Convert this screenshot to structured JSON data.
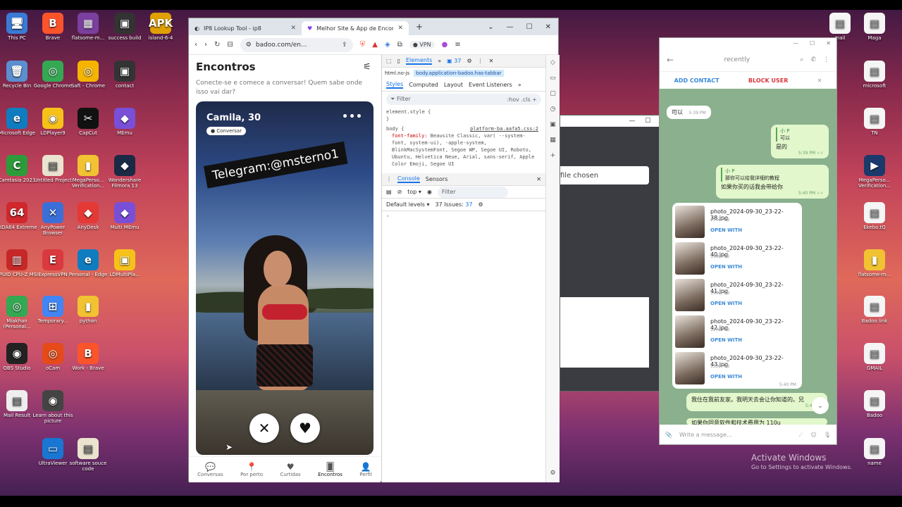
{
  "desktop_left": [
    {
      "label": "This PC",
      "color": "#3a7bd5",
      "glyph": "🖥"
    },
    {
      "label": "Brave",
      "color": "#fb542b",
      "glyph": "B"
    },
    {
      "label": "flatsome-m...",
      "color": "#7b3fa0",
      "glyph": "▦"
    },
    {
      "label": "success build",
      "color": "#333333",
      "glyph": "▣"
    },
    {
      "label": "island-6-4",
      "color": "#e0a000",
      "glyph": "APK"
    },
    {
      "label": "Recycle Bin",
      "color": "#5b8fd0",
      "glyph": "🗑"
    },
    {
      "label": "Google Chrome",
      "color": "#34a853",
      "glyph": "◎"
    },
    {
      "label": "Saft - Chrome",
      "color": "#f4b400",
      "glyph": "◎"
    },
    {
      "label": "contact",
      "color": "#333333",
      "glyph": "▣"
    },
    {
      "label": "Microsoft Edge",
      "color": "#0f7cc0",
      "glyph": "e"
    },
    {
      "label": "LDPlayer9",
      "color": "#f6c21a",
      "glyph": "◉"
    },
    {
      "label": "CapCut",
      "color": "#111111",
      "glyph": "✂"
    },
    {
      "label": "MEmu",
      "color": "#7a4fd8",
      "glyph": "◆"
    },
    {
      "label": "Camtasia 2023",
      "color": "#2d9b3a",
      "glyph": "C"
    },
    {
      "label": "Untitled Project",
      "color": "#e9e3d0",
      "glyph": "▤"
    },
    {
      "label": "MegaPerso... Verification...",
      "color": "#f1c232",
      "glyph": "▮"
    },
    {
      "label": "Wondershare Filmora 13",
      "color": "#1a2a44",
      "glyph": "◆"
    },
    {
      "label": "AIDA64 Extreme",
      "color": "#d0282d",
      "glyph": "64"
    },
    {
      "label": "AnyPower Browser",
      "color": "#3a6fd8",
      "glyph": "✕"
    },
    {
      "label": "AnyDesk",
      "color": "#e53935",
      "glyph": "◆"
    },
    {
      "label": "Multi MEmu",
      "color": "#7a4fd8",
      "glyph": "◆"
    },
    {
      "label": "CPUID CPU-Z MSI",
      "color": "#c62828",
      "glyph": "▥"
    },
    {
      "label": "ExpressVPN",
      "color": "#da3940",
      "glyph": "E"
    },
    {
      "label": "Personal - Edge",
      "color": "#0f7cc0",
      "glyph": "e"
    },
    {
      "label": "LDMultiPla...",
      "color": "#f6c21a",
      "glyph": "▣"
    },
    {
      "label": "Miakhan (Personal...",
      "color": "#34a853",
      "glyph": "◎"
    },
    {
      "label": "Temporary...",
      "color": "#4285f4",
      "glyph": "⊞"
    },
    {
      "label": "python",
      "color": "#f1c232",
      "glyph": "▮"
    },
    {
      "label": "OBS Studio",
      "color": "#222222",
      "glyph": "◉"
    },
    {
      "label": "oCam",
      "color": "#e64a19",
      "glyph": "◎"
    },
    {
      "label": "Work - Brave",
      "color": "#fb542b",
      "glyph": "B"
    },
    {
      "label": "Mail Result",
      "color": "#eeeeee",
      "glyph": "▤"
    },
    {
      "label": "Learn about this picture",
      "color": "#444444",
      "glyph": "◉"
    },
    {
      "label": "UltraViewer",
      "color": "#1976d2",
      "glyph": "▭"
    },
    {
      "label": "software souce code",
      "color": "#e9e3d0",
      "glyph": "▤"
    }
  ],
  "desktop_right": [
    {
      "label": "mail",
      "color": "#f5f5f5",
      "glyph": "▤"
    },
    {
      "label": "Maga",
      "color": "#f5f5f5",
      "glyph": "▤"
    },
    {
      "label": "microsoft",
      "color": "#f5f5f5",
      "glyph": "▤"
    },
    {
      "label": "TN",
      "color": "#f5f5f5",
      "glyph": "▤"
    },
    {
      "label": "MegaPerso... Verification...",
      "color": "#1b3a6b",
      "glyph": "▶"
    },
    {
      "label": "Ekebo.tQ",
      "color": "#f5f5f5",
      "glyph": "▤"
    },
    {
      "label": "flatsome-m...",
      "color": "#f1c232",
      "glyph": "▮"
    },
    {
      "label": "Badoo link",
      "color": "#f5f5f5",
      "glyph": "▤"
    },
    {
      "label": "GMAIL",
      "color": "#f5f5f5",
      "glyph": "▤"
    },
    {
      "label": "Badoo",
      "color": "#f5f5f5",
      "glyph": "▤"
    },
    {
      "label": "name",
      "color": "#f5f5f5",
      "glyph": "▤"
    }
  ],
  "browser": {
    "tabs": [
      {
        "label": "IP8 Lookup Tool - ip8",
        "active": false
      },
      {
        "label": "Melhor Site & App de Encontro",
        "active": true
      }
    ],
    "new_tab": "+",
    "url": "badoo.com/en...",
    "vpn": "VPN",
    "page": {
      "title": "Encontros",
      "subtitle": "Conecte-se e comece a conversar! Quem sabe onde isso vai dar?",
      "card": {
        "name": "Camila, 30",
        "chip": "Conversar",
        "banner": "Telegram:@msterno1",
        "more": "•••"
      },
      "nav": [
        {
          "label": "Conversas",
          "icon": "chat-icon",
          "glyph": "💬",
          "active": false
        },
        {
          "label": "Por perto",
          "icon": "location-icon",
          "glyph": "📍",
          "active": false
        },
        {
          "label": "Curtidas",
          "icon": "heart-icon",
          "glyph": "♥",
          "active": false
        },
        {
          "label": "Encontros",
          "icon": "cards-icon",
          "glyph": "🂠",
          "active": true
        },
        {
          "label": "Perfil",
          "icon": "profile-icon",
          "glyph": "👤",
          "active": false
        }
      ]
    },
    "devtools": {
      "top_tab": "Elements",
      "issues": "37",
      "crumbs": [
        "html.no-js",
        "body.application-badoo.has-tabbar"
      ],
      "style_tabs": [
        "Styles",
        "Computed",
        "Layout",
        "Event Listeners"
      ],
      "filter": "Filter",
      "hov": ":hov",
      "cls": ".cls",
      "element_style": "element.style {",
      "close_brace": "}",
      "body_rule": "body {",
      "body_file": "platform-ba.aafa5.css:2",
      "font_prop": "font-family:",
      "font_value": "Beausite Classic, var( --system-font, system-ui), -apple-system, BlinkMacSystemFont, Segoe WP, Segoe UI, Roboto, Ubuntu, Helvetica Neue, Arial, sans-serif, Apple Color Emoji, Segoe UI",
      "console_tab": "Console",
      "sensors_tab": "Sensors",
      "context": "top",
      "levels": "Default levels",
      "issues_text": "37 Issues:",
      "issues_count": "37",
      "prompt": "›"
    }
  },
  "file_window": {
    "file_text": "file chosen"
  },
  "telegram": {
    "header_status": "recently",
    "add_contact": "ADD CONTACT",
    "block_user": "BLOCK USER",
    "messages": [
      {
        "text": "可以",
        "time": "5:39 PM",
        "out": false
      },
      {
        "reply": "小 P",
        "reply_text": "可以",
        "text": "是的",
        "time": "5:39 PM",
        "out": true
      },
      {
        "reply": "小 P",
        "reply_text": "那你可以给我详细的教程",
        "text": "如果你买的话我会带给你",
        "time": "5:40 PM",
        "out": true
      },
      {
        "text": "我住在我前友家。我明天去会让你知道的。兄",
        "time": "5:40 PM",
        "out": false
      },
      {
        "text": "如果你同意软件和技术费用为 110u",
        "time": "",
        "out": false
      }
    ],
    "photos": [
      {
        "name": "photo_2024-09-30_23-22-38.jpg",
        "size": "235.3 KB",
        "open": "OPEN WITH"
      },
      {
        "name": "photo_2024-09-30_23-22-40.jpg",
        "size": "198.6 KB",
        "open": "OPEN WITH"
      },
      {
        "name": "photo_2024-09-30_23-22-41.jpg",
        "size": "199.3 KB",
        "open": "OPEN WITH"
      },
      {
        "name": "photo_2024-09-30_23-22-42.jpg",
        "size": "123.1 KB",
        "open": "OPEN WITH"
      },
      {
        "name": "photo_2024-09-30_23-22-43.jpg",
        "size": "153.4 KB",
        "open": "OPEN WITH"
      }
    ],
    "photos_time": "5:40 PM",
    "input_placeholder": "Write a message..."
  },
  "activate": {
    "title": "Activate Windows",
    "sub": "Go to Settings to activate Windows."
  }
}
